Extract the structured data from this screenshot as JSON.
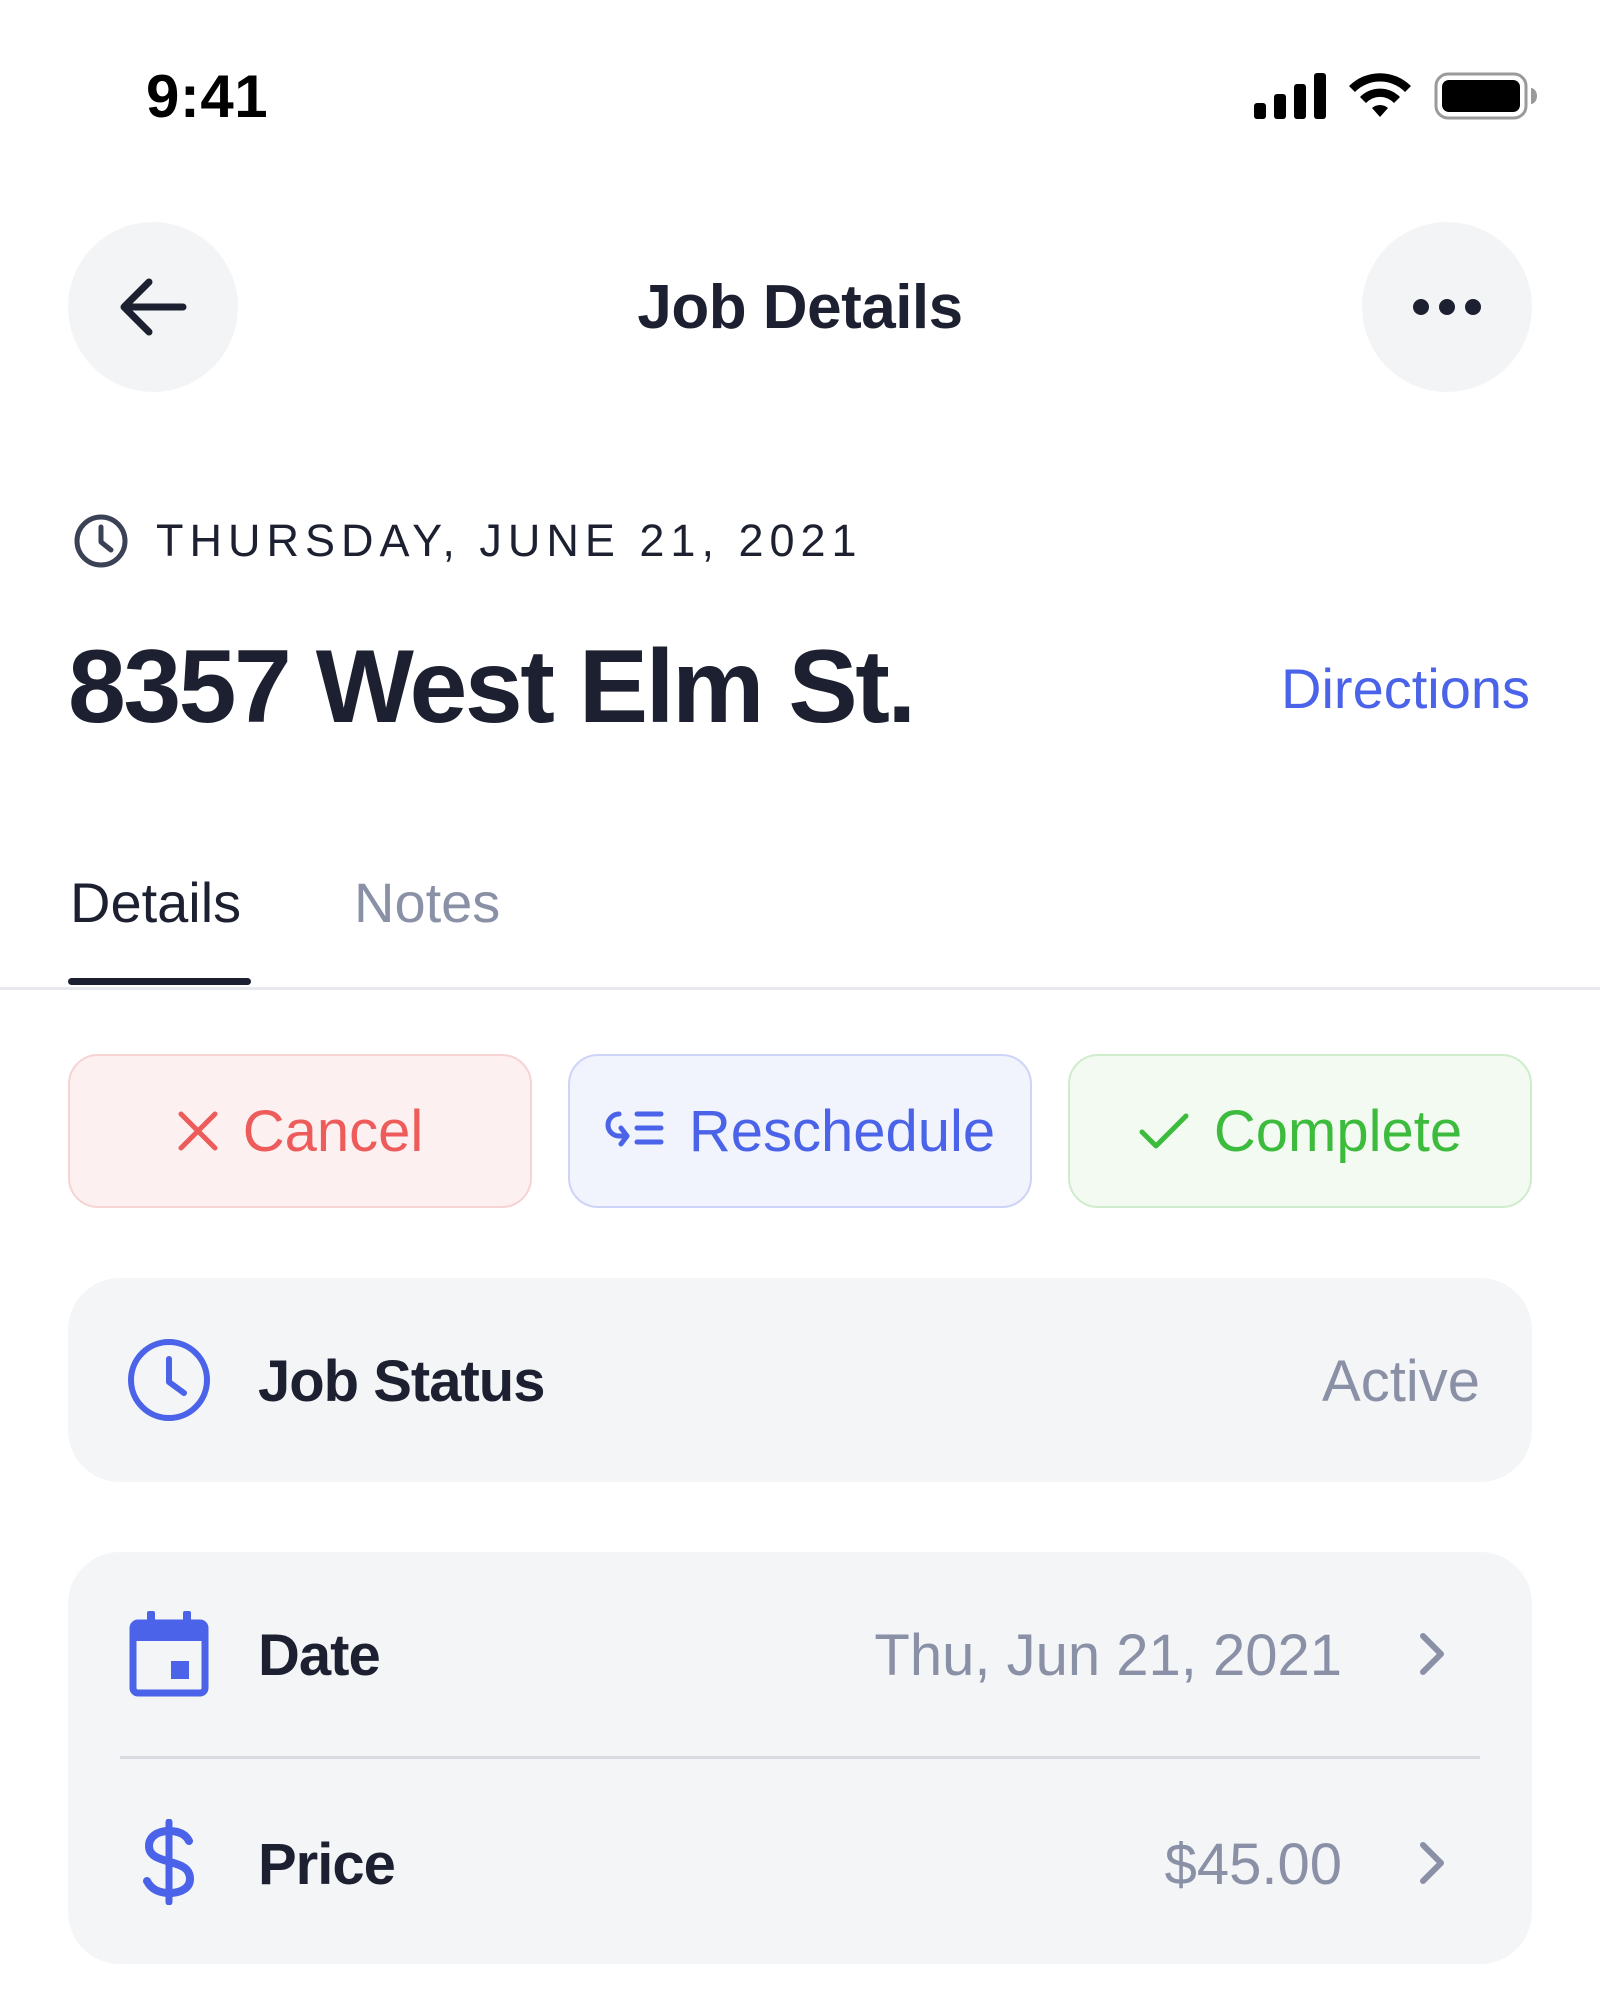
{
  "status_bar": {
    "time": "9:41",
    "icons": [
      "cellular-signal-icon",
      "wifi-icon",
      "battery-icon"
    ]
  },
  "header": {
    "title": "Job Details",
    "back_icon": "arrow-left-icon",
    "more_icon": "ellipsis-icon"
  },
  "job": {
    "date_label": "THURSDAY, JUNE 21, 2021",
    "address": "8357 West Elm St.",
    "directions_label": "Directions"
  },
  "tabs": [
    {
      "label": "Details",
      "active": true
    },
    {
      "label": "Notes",
      "active": false
    }
  ],
  "actions": {
    "cancel_label": "Cancel",
    "reschedule_label": "Reschedule",
    "complete_label": "Complete"
  },
  "status": {
    "label": "Job Status",
    "value": "Active"
  },
  "details": {
    "date_label": "Date",
    "date_value": "Thu, Jun 21, 2021",
    "price_label": "Price",
    "price_value": "$45.00"
  },
  "colors": {
    "text": "#1c2030",
    "muted": "#8a90a6",
    "accent_blue": "#4a63e8",
    "danger": "#ee5b5b",
    "success": "#3dbb3d",
    "card_bg": "#f4f5f7"
  }
}
